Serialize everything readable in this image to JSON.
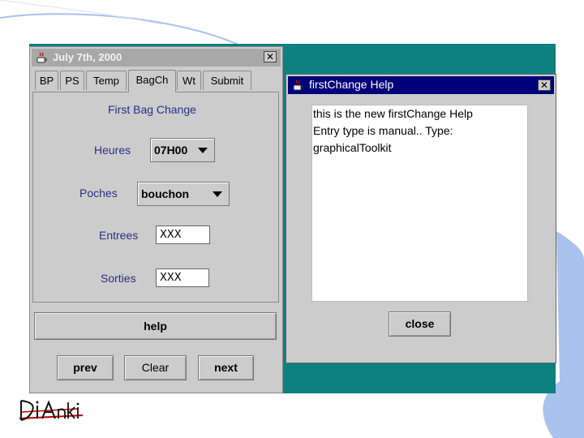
{
  "left_window": {
    "title": "July 7th, 2000",
    "tabs": [
      {
        "label": "BP"
      },
      {
        "label": "PS"
      },
      {
        "label": "Temp"
      },
      {
        "label": "BagCh"
      },
      {
        "label": "Wt"
      },
      {
        "label": "Submit"
      }
    ],
    "active_tab": "BagCh",
    "panel_title": "First Bag Change",
    "heures": {
      "label": "Heures",
      "value": "07H00"
    },
    "poches": {
      "label": "Poches",
      "value": "bouchon"
    },
    "entrees": {
      "label": "Entrees",
      "value": "XXX"
    },
    "sorties": {
      "label": "Sorties",
      "value": "XXX"
    },
    "help_label": "help",
    "prev_label": "prev",
    "clear_label": "Clear",
    "next_label": "next"
  },
  "help_window": {
    "title": "firstChange Help",
    "lines": [
      "this is the new firstChange Help",
      "Entry type is manual.. Type:",
      "graphicalToolkit"
    ],
    "close_label": "close"
  },
  "logo": {
    "text": "DiAnki"
  },
  "colors": {
    "backdrop": "#0e8080",
    "window_bg": "#cccccc",
    "active_title": "#00007a",
    "label_text": "#2d2d88",
    "deco_arc": "#a9c2ee"
  },
  "icons": [
    "java-coffee-icon",
    "close-icon",
    "dropdown-arrow-icon"
  ]
}
